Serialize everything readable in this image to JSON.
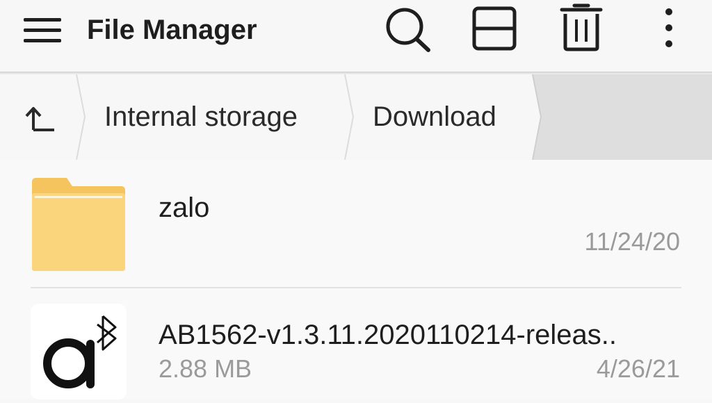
{
  "appbar": {
    "title": "File Manager",
    "icons": [
      "menu-icon",
      "search-icon",
      "view-toggle-icon",
      "delete-icon",
      "more-vert-icon"
    ]
  },
  "breadcrumb": {
    "up_icon": "arrow-up-icon",
    "items": [
      {
        "label": "Internal storage"
      },
      {
        "label": "Download"
      }
    ]
  },
  "files": [
    {
      "name": "zalo",
      "type": "folder",
      "icon": "folder-icon",
      "date": "11/24/20",
      "size": ""
    },
    {
      "name": "AB1562-v1.3.11.2020110214-releas..",
      "type": "file",
      "icon": "bluetooth-app-icon",
      "date": "4/26/21",
      "size": "2.88 MB"
    }
  ],
  "colors": {
    "background": "#f7f7f7",
    "folder": "#fbd57c",
    "secondary_text": "#9a9a9a",
    "crumb_bg": "#dedede"
  }
}
